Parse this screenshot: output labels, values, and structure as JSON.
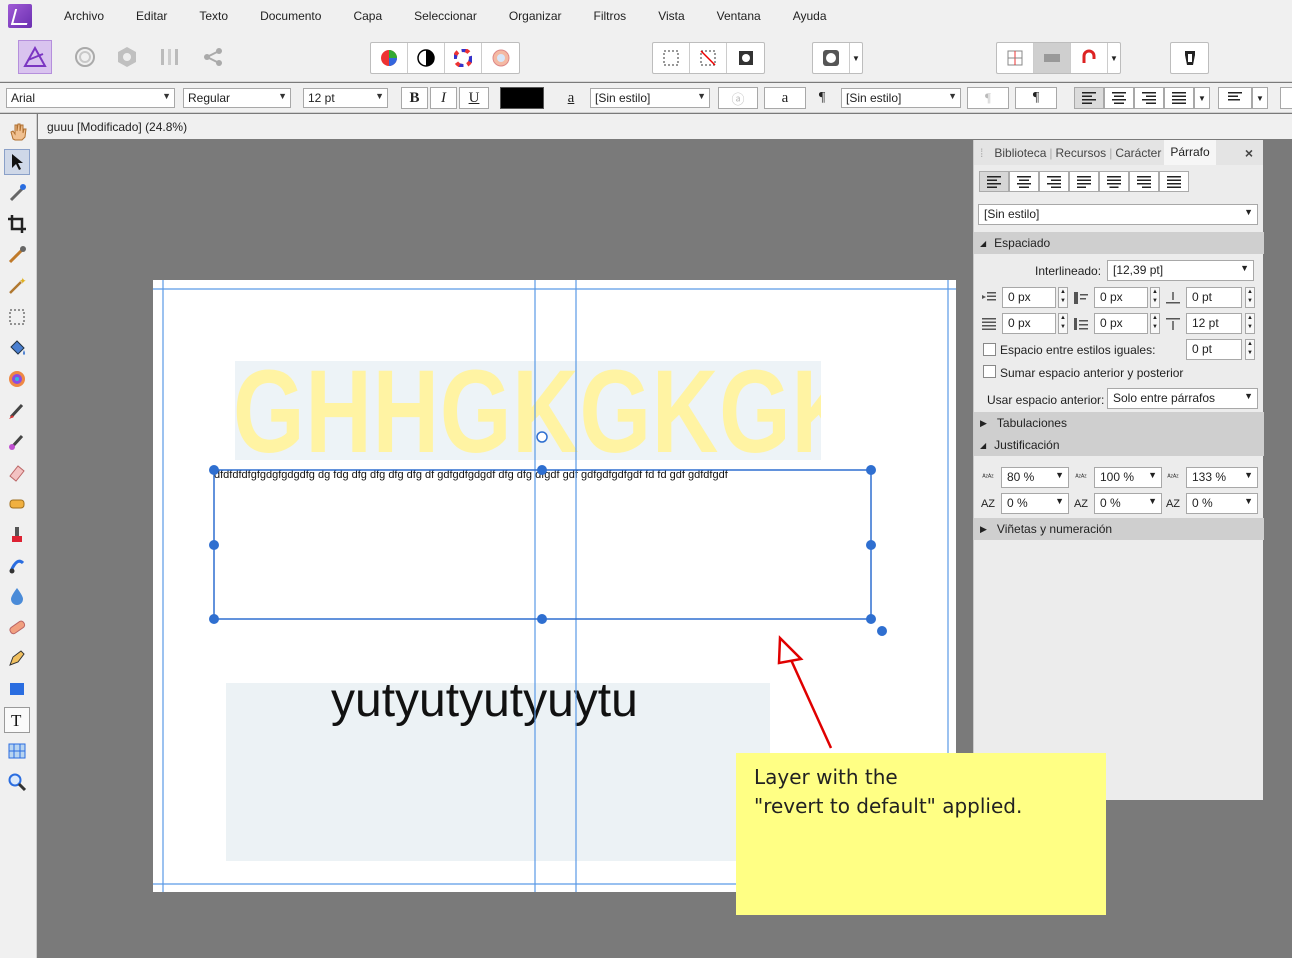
{
  "menu": [
    "Archivo",
    "Editar",
    "Texto",
    "Documento",
    "Capa",
    "Seleccionar",
    "Organizar",
    "Filtros",
    "Vista",
    "Ventana",
    "Ayuda"
  ],
  "context": {
    "font_family": "Arial",
    "font_style": "Regular",
    "font_size": "12 pt",
    "char_style": "[Sin estilo]",
    "para_style": "[Sin estilo]"
  },
  "document": {
    "title": "guuu [Modificado] (24.8%)"
  },
  "canvas": {
    "heading_text": "GHHGKGKGK",
    "body_line": "dfdfdfdfgfgdgfgdgdfg dg fdg dfg dfg dfg dfg df gdfgdfgdgdf dfg dfg dfgdf gdf gdfgdfgdfgdf fd fd gdf gdfdfgdf",
    "large_text": "yutyutyutyuytu",
    "heading_color": "#fff3a3"
  },
  "panel": {
    "tabs": [
      "Biblioteca",
      "Recursos",
      "Carácter",
      "Párrafo"
    ],
    "active_tab": "Párrafo",
    "style_select": "[Sin estilo]",
    "sections": {
      "spacing": "Espaciado",
      "tabs": "Tabulaciones",
      "justification": "Justificación",
      "bullets": "Viñetas y numeración"
    },
    "leading_label": "Interlineado:",
    "leading_value": "[12,39 pt]",
    "spacing_values": [
      "0 px",
      "0 px",
      "0 pt",
      "0 px",
      "0 px",
      "12 pt"
    ],
    "same_style_label": "Espacio entre estilos iguales:",
    "same_style_value": "0 pt",
    "add_spacing_label": "Sumar espacio anterior y posterior",
    "use_before_label": "Usar espacio anterior:",
    "use_before_value": "Solo entre párrafos",
    "justification_values": [
      "80 %",
      "100 %",
      "133 %",
      "0 %",
      "0 %",
      "0 %"
    ]
  },
  "note": {
    "line1": "Layer with the",
    "line2": "\"revert to default\" applied."
  },
  "colors": {
    "accent": "#3a7bd5",
    "note_bg": "#ffff84",
    "arrow": "#e00000",
    "text_fill": "#000000"
  }
}
